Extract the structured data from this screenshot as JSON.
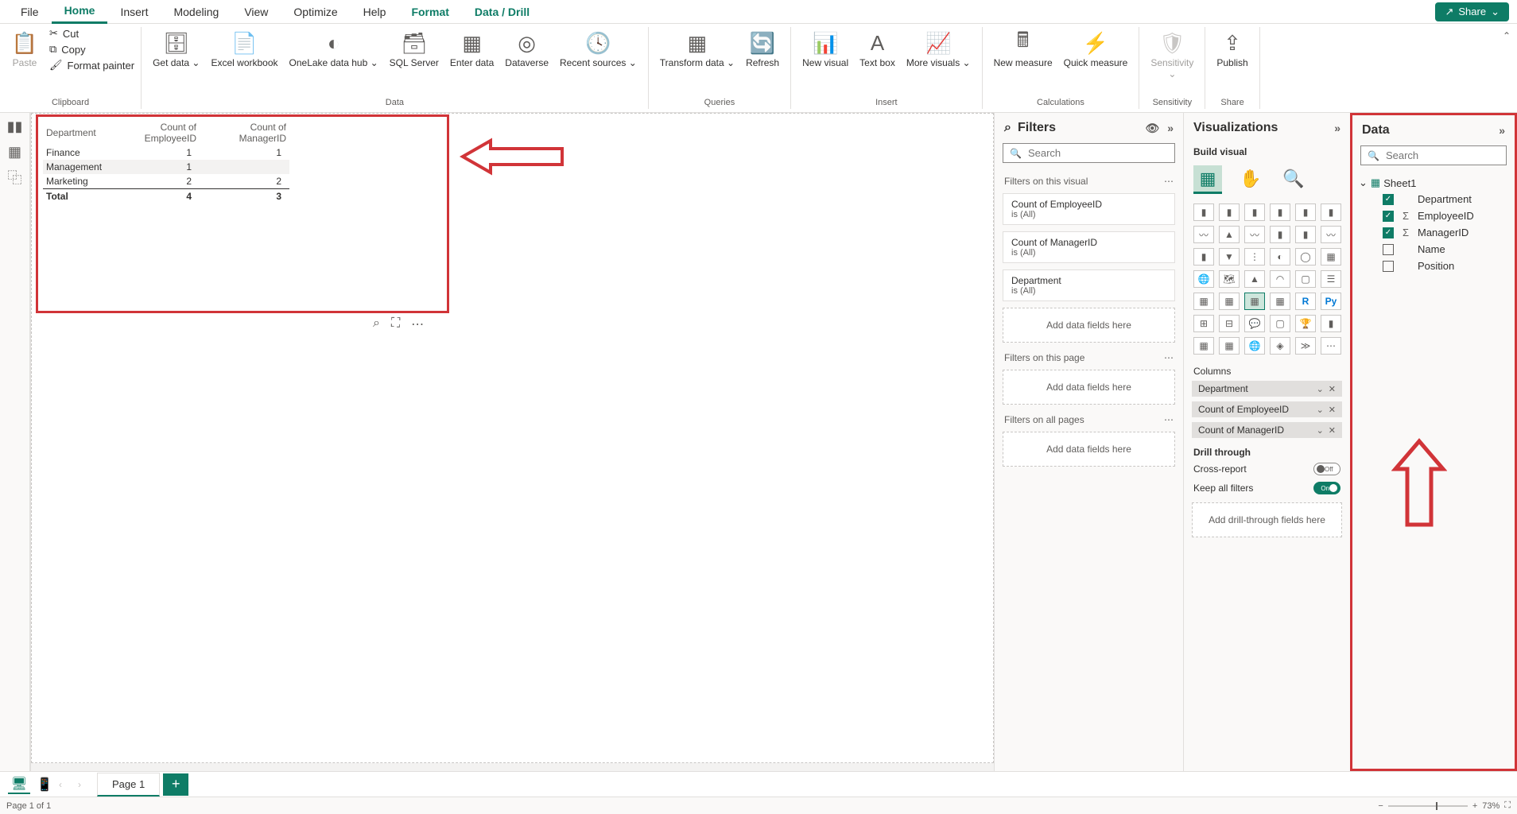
{
  "menu": {
    "tabs": [
      "File",
      "Home",
      "Insert",
      "Modeling",
      "View",
      "Optimize",
      "Help",
      "Format",
      "Data / Drill"
    ],
    "active": "Home",
    "share": "Share"
  },
  "ribbon": {
    "paste": "Paste",
    "cut": "Cut",
    "copy": "Copy",
    "format_painter": "Format painter",
    "clipboard": "Clipboard",
    "get_data": "Get data",
    "excel": "Excel workbook",
    "onelake": "OneLake data hub",
    "sql": "SQL Server",
    "enter": "Enter data",
    "dataverse": "Dataverse",
    "recent": "Recent sources",
    "data_group": "Data",
    "transform": "Transform data",
    "refresh": "Refresh",
    "queries": "Queries",
    "new_visual": "New visual",
    "text_box": "Text box",
    "more_visuals": "More visuals",
    "insert": "Insert",
    "new_measure": "New measure",
    "quick_measure": "Quick measure",
    "calculations": "Calculations",
    "sensitivity": "Sensitivity",
    "sensitivity_group": "Sensitivity",
    "publish": "Publish",
    "share_group": "Share"
  },
  "table_visual": {
    "headers": [
      "Department",
      "Count of EmployeeID",
      "Count of ManagerID"
    ],
    "rows": [
      {
        "dept": "Finance",
        "emp": "1",
        "mgr": "1"
      },
      {
        "dept": "Management",
        "emp": "1",
        "mgr": ""
      },
      {
        "dept": "Marketing",
        "emp": "2",
        "mgr": "2"
      }
    ],
    "total_label": "Total",
    "total_emp": "4",
    "total_mgr": "3"
  },
  "filters": {
    "title": "Filters",
    "search_placeholder": "Search",
    "on_visual": "Filters on this visual",
    "cards": [
      {
        "name": "Count of EmployeeID",
        "sub": "is (All)"
      },
      {
        "name": "Count of ManagerID",
        "sub": "is (All)"
      },
      {
        "name": "Department",
        "sub": "is (All)"
      }
    ],
    "on_page": "Filters on this page",
    "on_all": "Filters on all pages",
    "add_fields": "Add data fields here"
  },
  "viz": {
    "title": "Visualizations",
    "build": "Build visual",
    "columns": "Columns",
    "chips": [
      "Department",
      "Count of EmployeeID",
      "Count of ManagerID"
    ],
    "drill": "Drill through",
    "cross": "Cross-report",
    "cross_state": "Off",
    "keep": "Keep all filters",
    "keep_state": "On",
    "add_drill": "Add drill-through fields here"
  },
  "data": {
    "title": "Data",
    "search_placeholder": "Search",
    "table_name": "Sheet1",
    "fields": [
      {
        "name": "Department",
        "checked": true,
        "sigma": false
      },
      {
        "name": "EmployeeID",
        "checked": true,
        "sigma": true
      },
      {
        "name": "ManagerID",
        "checked": true,
        "sigma": true
      },
      {
        "name": "Name",
        "checked": false,
        "sigma": false
      },
      {
        "name": "Position",
        "checked": false,
        "sigma": false
      }
    ]
  },
  "pages": {
    "page1": "Page 1"
  },
  "status": {
    "page": "Page 1 of 1",
    "zoom": "73%"
  }
}
